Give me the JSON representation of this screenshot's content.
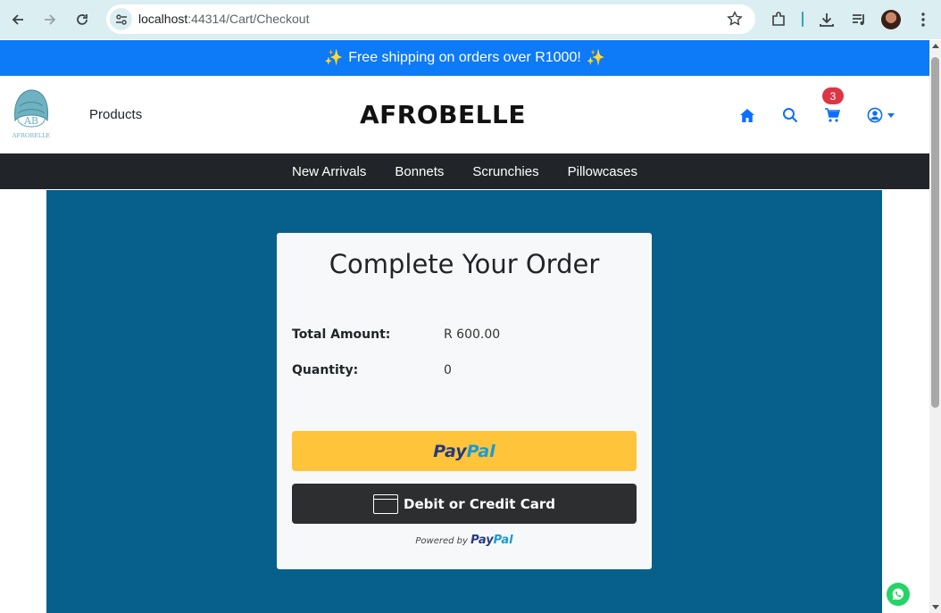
{
  "browser": {
    "url_host": "localhost",
    "url_path": ":44314/Cart/Checkout"
  },
  "promo": {
    "text": "Free shipping on orders over R1000!",
    "sparkle_left": "✨",
    "sparkle_right": "✨"
  },
  "header": {
    "logo_text": "AB",
    "logo_subtext": "AFROBELLE",
    "products_label": "Products",
    "brand": "AFROBELLE",
    "cart_count": "3"
  },
  "categories": [
    "New Arrivals",
    "Bonnets",
    "Scrunchies",
    "Pillowcases"
  ],
  "checkout": {
    "title": "Complete Your Order",
    "total_label": "Total Amount:",
    "total_value": "R 600.00",
    "quantity_label": "Quantity:",
    "quantity_value": "0",
    "paypal_pay": "Pay",
    "paypal_pal": "Pal",
    "card_button_label": "Debit or Credit Card",
    "powered_by": "Powered by",
    "powered_pay": "Pay",
    "powered_pal": "Pal"
  },
  "icons": {
    "back": "arrow-left-icon",
    "forward": "arrow-right-icon",
    "reload": "reload-icon",
    "home": "home-icon",
    "search": "search-icon",
    "cart": "cart-icon",
    "account": "user-circle-icon",
    "whatsapp": "whatsapp-icon"
  },
  "colors": {
    "promo_bar": "#0d7af8",
    "category_bar": "#212529",
    "main_bg": "#07608c",
    "paypal_yellow": "#ffc43a",
    "card_button": "#2c2e2f",
    "badge": "#dc3545",
    "nav_icon": "#0d6efd"
  }
}
